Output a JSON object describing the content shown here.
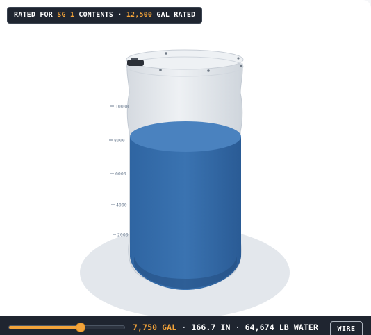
{
  "rating": {
    "prefix": "RATED FOR",
    "sg_value": "SG 1",
    "middle": "CONTENTS ·",
    "gal_value": "12,500",
    "suffix": "GAL RATED"
  },
  "gauge": {
    "ticks": [
      "10000",
      "8000",
      "6000",
      "4000",
      "2000"
    ]
  },
  "tank": {
    "fill_fraction": 0.62,
    "capacity_gal": 12500,
    "colors": {
      "water": "#3a73b1",
      "water_top": "#4a82bf",
      "tank_shell": "#dfe3e8",
      "shadow": "#e3e7ec"
    }
  },
  "bottom_bar": {
    "slider_value": 0.62,
    "gallons": "7,750 GAL",
    "sep1": "·",
    "height": "166.7 IN",
    "sep2": "·",
    "weight": "64,674 LB WATER",
    "wire_label": "WIRE"
  },
  "colors": {
    "accent": "#f2a33a",
    "bar_bg": "#1f2530"
  }
}
